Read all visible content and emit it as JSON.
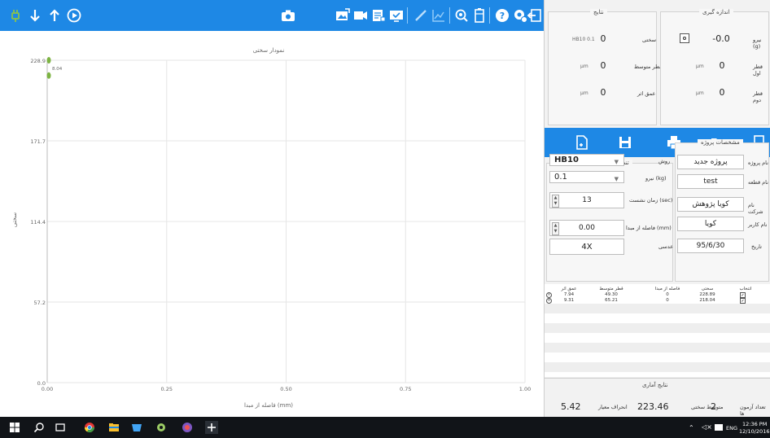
{
  "toolbar": {
    "left_icons": [
      "plug-icon",
      "arrow-down-icon",
      "arrow-up-icon",
      "play-circle-icon"
    ],
    "center_icon": "camera-icon",
    "right_icons": [
      "image-export-icon",
      "video-icon",
      "report-icon",
      "screen-icon",
      "pencil-icon",
      "chart-icon",
      "zoom-icon",
      "battery-icon",
      "help-icon",
      "settings-wrench-icon",
      "exit-icon"
    ],
    "colors": {
      "bar": "#1e88e5",
      "icon": "#ffffff"
    }
  },
  "chart": {
    "title": "نمودار سختی",
    "xlabel": "فاصله از مبدا (mm)",
    "ylabel": "سختی",
    "y_ticks": [
      "228.9",
      "171.7",
      "114.4",
      "57.2",
      "0.0"
    ],
    "x_ticks": [
      "0.00",
      "0.25",
      "0.50",
      "0.75",
      "1.00"
    ],
    "point_label": "8.04"
  },
  "chart_data": {
    "type": "scatter",
    "title": "نمودار سختی",
    "xlabel": "فاصله از مبدا (mm)",
    "ylabel": "سختی",
    "xlim": [
      0,
      1
    ],
    "ylim": [
      0,
      228.9
    ],
    "grid": true,
    "series": [
      {
        "x": [
          0,
          0
        ],
        "y": [
          228.89,
          218.04
        ],
        "color": "#7cb342"
      }
    ]
  },
  "measurement": {
    "title": "اندازه گیری",
    "rows": [
      {
        "label": "نیرو (g)",
        "value": "-0.0",
        "unit": ""
      },
      {
        "label": "قطر اول",
        "value": "0",
        "unit": "µm"
      },
      {
        "label": "قطر دوم",
        "value": "0",
        "unit": "µm"
      }
    ],
    "toggle_icon": "target-icon"
  },
  "results": {
    "title": "نتایج",
    "rows": [
      {
        "label": "سختی",
        "value": "0",
        "unit": "HB10 0.1"
      },
      {
        "label": "قطر متوسط",
        "value": "0",
        "unit": "µm"
      },
      {
        "label": "عمق اثر",
        "value": "0",
        "unit": "µm"
      }
    ]
  },
  "filebar": {
    "icons": [
      "new-file-icon",
      "save-icon",
      "print-icon",
      "open-folder-icon",
      "export-icon"
    ]
  },
  "project": {
    "title": "مشخصات پروژه",
    "fields": [
      {
        "label": "نام پروژه",
        "value": "پروژه جدید"
      },
      {
        "label": "نام قطعه",
        "value": "test"
      },
      {
        "label": "نام شرکت",
        "value": "کویا پژوهش"
      },
      {
        "label": "نام کاربر",
        "value": "کویا"
      },
      {
        "label": "تاریخ",
        "value": "95/6/30"
      }
    ]
  },
  "device": {
    "title": "تنظیمات دستگاه",
    "method_label": "روش",
    "method_value": "HB10",
    "force_label": "نیرو (kg)",
    "force_value": "0.1",
    "dwell_label": "زمان نشست (sec)",
    "dwell_value": "13",
    "distance_label": "فاصله از مبدا (mm)",
    "distance_value": "0.00",
    "lens_label": "عدسی",
    "lens_value": "4X"
  },
  "table": {
    "headers": [
      "عمق اثر",
      "قطر متوسط",
      "فاصله از مبدا",
      "سختی",
      "انتخاب"
    ],
    "rows": [
      {
        "depth": "7.94",
        "diameter": "49.30",
        "distance": "0",
        "hardness": "228.89",
        "selected": true
      },
      {
        "depth": "9.31",
        "diameter": "65.21",
        "distance": "0",
        "hardness": "218.04",
        "selected": true
      }
    ]
  },
  "stats": {
    "title": "نتایج آماری",
    "count_label": "تعداد آزمون ها",
    "count_value": "2",
    "mean_label": "متوسط سختی",
    "mean_value": "223.46",
    "std_label": "انحراف معیار",
    "std_value": "5.42"
  },
  "taskbar": {
    "apps": [
      "windows-start-icon",
      "search-icon",
      "task-view-icon",
      "chrome-icon",
      "file-explorer-icon",
      "store-icon",
      "settings-icon",
      "browser-icon",
      "app-icon"
    ],
    "language": "ENG",
    "time": "12:36 PM",
    "date": "12/10/2016"
  }
}
